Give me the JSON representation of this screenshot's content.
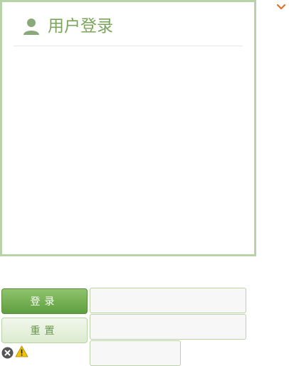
{
  "login_panel": {
    "title": "用户登录",
    "icon": "user-icon"
  },
  "actions": {
    "login_label": "登录",
    "reset_label": "重置"
  },
  "form": {
    "username": {
      "value": "",
      "placeholder": ""
    },
    "password": {
      "value": "",
      "placeholder": ""
    },
    "captcha": {
      "value": "",
      "placeholder": ""
    }
  },
  "colors": {
    "accent": "#7aa55c",
    "panel_border": "#b8d3a8",
    "login_button": "#6fae4b",
    "chevron": "#e0702a",
    "warning": "#f2c200"
  }
}
